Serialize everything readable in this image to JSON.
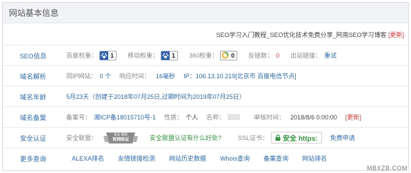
{
  "header": {
    "title": "网站基本信息"
  },
  "site_line": {
    "text": "SEO学习入门教程_SEO优化技术免费分享_阿南SEO学习博客",
    "update": "[更新]"
  },
  "seo": {
    "label": "SEO信息",
    "baidu_weight_label": "百度权重：",
    "baidu_weight": "1",
    "mobile_weight_label": "移动权重：",
    "mobile_weight": "1",
    "so360_label": "360权重：",
    "so360_weight": "0",
    "backlinks_label": "反链数：",
    "backlinks": "0",
    "outlinks_label": "出站链接：",
    "outlinks": "重试"
  },
  "dns": {
    "label": "域名解析",
    "same_ip_label": "同IP网站：",
    "same_ip": "0 个",
    "response_label": "响应时间：",
    "response": "16毫秒",
    "ip_label": "IP：",
    "ip": "106.13.10.219[北京市 百度电信节点]"
  },
  "age": {
    "label": "域名年龄",
    "text": "5月23天（创建于2018年07月25日,过期时间为2019年07月25日）"
  },
  "icp": {
    "label": "域名备案",
    "number_label": "备案号：",
    "number": "湘ICP备18015710号-1",
    "nature_label": "性质：",
    "nature": "个人",
    "name_label": "名称：",
    "audit_label": "审核时间：",
    "audit_time": "2018/8/6 0:00:00",
    "update": "[更新]"
  },
  "security": {
    "label": "安全认证",
    "alliance_label": "安全联盟：",
    "seal_top": "安全·联盟",
    "seal_text": "官网验证",
    "alliance_link": "安全联盟认证有什么好处?",
    "ssl_label": "SSL证书：",
    "ssl_badge": "安全 https:",
    "ssl_link": "免费申请"
  },
  "more": {
    "label": "更多查询",
    "links": [
      "ALEXA排名",
      "友情链接检测",
      "网站历史数据",
      "Whois查询",
      "备案查询",
      "网站排名"
    ]
  },
  "watermark": "MBXZB.COM",
  "colors": {
    "link": "#2a6bb5",
    "update": "#e03a3a",
    "ssl": "#2e9a3a",
    "header_bg": "#f1f3f6"
  }
}
